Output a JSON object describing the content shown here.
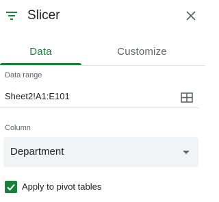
{
  "header": {
    "title": "Slicer",
    "icon": "filter-icon",
    "close_icon": "close-icon"
  },
  "tabs": [
    {
      "label": "Data",
      "active": true
    },
    {
      "label": "Customize",
      "active": false
    }
  ],
  "data_range": {
    "label": "Data range",
    "value": "Sheet2!A1:E101",
    "icon": "grid-icon"
  },
  "column": {
    "label": "Column",
    "selected": "Department",
    "icon": "caret-down-icon"
  },
  "apply_pivot": {
    "label": "Apply to pivot tables",
    "checked": true
  },
  "colors": {
    "accent": "#188038",
    "text": "#202124",
    "muted": "#5f6368",
    "field_bg": "#f1f3f4",
    "divider": "#e0e0e0"
  }
}
